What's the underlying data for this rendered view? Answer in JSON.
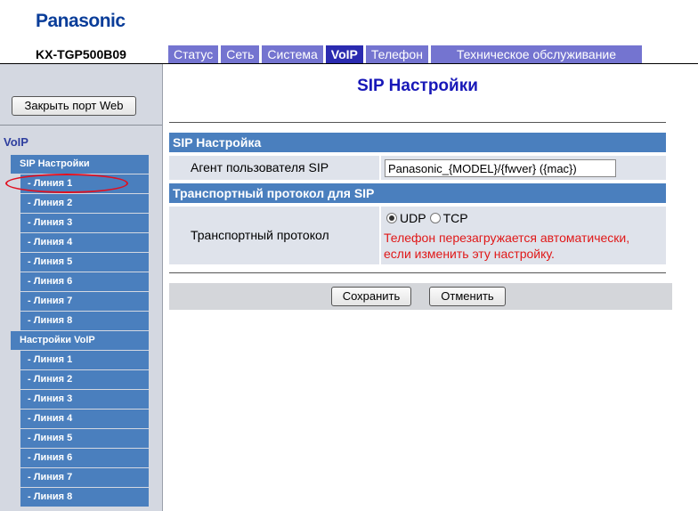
{
  "header": {
    "brand": "Panasonic",
    "model": "KX-TGP500B09",
    "tabs": [
      {
        "label": "Статус",
        "active": false
      },
      {
        "label": "Сеть",
        "active": false
      },
      {
        "label": "Система",
        "active": false
      },
      {
        "label": "VoIP",
        "active": true
      },
      {
        "label": "Телефон",
        "active": false
      },
      {
        "label": "Техническое обслуживание",
        "active": false
      }
    ]
  },
  "sidebar": {
    "close_button": "Закрыть порт Web",
    "section": "VoIP",
    "groups": [
      {
        "label": "SIP Настройки",
        "items": [
          "- Линия 1",
          "- Линия 2",
          "- Линия 3",
          "- Линия 4",
          "- Линия 5",
          "- Линия 6",
          "- Линия 7",
          "- Линия 8"
        ]
      },
      {
        "label": "Настройки VoIP",
        "items": [
          "- Линия 1",
          "- Линия 2",
          "- Линия 3",
          "- Линия 4",
          "- Линия 5",
          "- Линия 6",
          "- Линия 7",
          "- Линия 8"
        ]
      }
    ]
  },
  "main": {
    "title": "SIP Настройки",
    "section1": {
      "title": "SIP Настройка",
      "agent_label": "Агент пользователя SIP",
      "agent_value": "Panasonic_{MODEL}/{fwver} ({mac})"
    },
    "section2": {
      "title": "Транспортный протокол для SIP",
      "transport_label": "Транспортный протокол",
      "udp_label": "UDP",
      "tcp_label": "TCP",
      "selected": "UDP",
      "warning_line1": "Телефон перезагружается автоматически,",
      "warning_line2": "если изменить эту настройку."
    },
    "save_button": "Сохранить",
    "cancel_button": "Отменить"
  },
  "colors": {
    "menu_blue": "#4a7fbe",
    "tab_purple": "#7474d0",
    "tab_active": "#2b2bb0",
    "title_blue": "#1818b8",
    "warning_red": "#e01818",
    "highlight_ellipse": "#e01020"
  }
}
